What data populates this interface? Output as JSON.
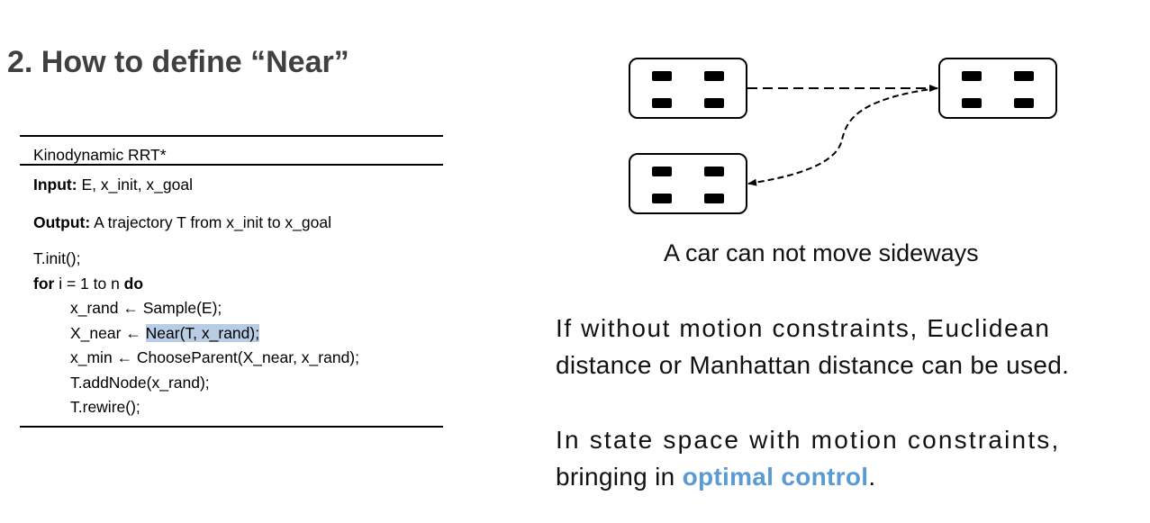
{
  "title": "2. How to define  “Near”",
  "algorithm": {
    "name": "Kinodynamic RRT*",
    "input_label": "Input:",
    "input_value": " E, x_init, x_goal",
    "output_label": "Output:",
    "output_value": " A trajectory T from x_init to x_goal",
    "line_init": "T.init();",
    "for_kw": "for",
    "for_mid": " i = 1 to n ",
    "do_kw": "do",
    "line_rand": "x_rand ← Sample(E);",
    "line_near_prefix": "X_near ← ",
    "line_near_highlight": "Near(T, x_rand);",
    "line_min": "x_min ← ChooseParent(X_near, x_rand);",
    "line_add": "T.addNode(x_rand);",
    "line_rewire": "T.rewire();"
  },
  "diagram": {
    "caption": "A car can not move sideways"
  },
  "paragraph1": {
    "line1": "If without motion constraints, Euclidean",
    "line2": "distance or Manhattan distance can be used."
  },
  "paragraph2": {
    "line1": "In state space with motion constraints,",
    "line2_prefix": "bringing in ",
    "line2_accent": "optimal control",
    "line2_suffix": "."
  },
  "colors": {
    "title": "#404040",
    "highlight": "#b8cce4",
    "accent": "#5b9bd5"
  }
}
